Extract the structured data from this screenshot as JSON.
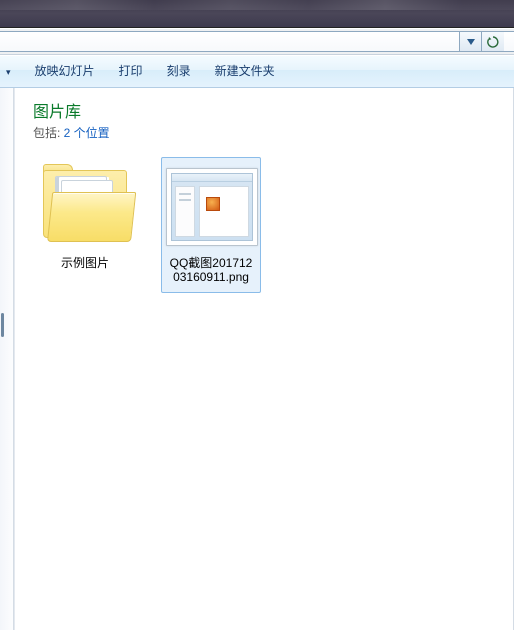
{
  "toolbar": {
    "slideshow": "放映幻灯片",
    "print": "打印",
    "burn": "刻录",
    "new_folder": "新建文件夹"
  },
  "library": {
    "title": "图片库",
    "includes_label": "包括: ",
    "includes_link": "2 个位置"
  },
  "items": [
    {
      "label": "示例图片"
    },
    {
      "label": "QQ截图20171203160911.png"
    }
  ]
}
